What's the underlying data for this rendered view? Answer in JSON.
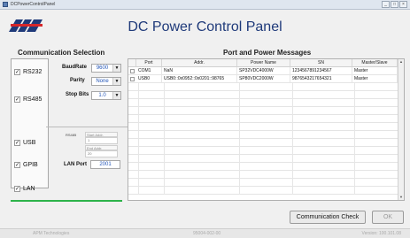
{
  "window": {
    "title": "DCPowerControlPanel"
  },
  "app": {
    "title": "DC Power Control Panel"
  },
  "sections": {
    "comm": "Communication Selection",
    "ports": "Port and Power Messages"
  },
  "comm_options": [
    {
      "label": "RS232",
      "checked": true
    },
    {
      "label": "RS485",
      "checked": true
    },
    {
      "label": "USB",
      "checked": true
    },
    {
      "label": "GPIB",
      "checked": true
    },
    {
      "label": "LAN",
      "checked": true
    }
  ],
  "rs232": {
    "baudrate_label": "BaudRate",
    "baudrate_value": "9600",
    "parity_label": "Parity",
    "parity_value": "None",
    "stopbits_label": "Stop Bits",
    "stopbits_value": "1.0"
  },
  "rs485": {
    "label": "RS485",
    "start_addr_placeholder": "Start Addr.",
    "start_addr_value": "1",
    "end_addr_placeholder": "End Addr.",
    "end_addr_value": "20"
  },
  "lan": {
    "port_label": "LAN Port",
    "port_value": "2001"
  },
  "table": {
    "columns": [
      "Port",
      "Addr.",
      "Power Name",
      "SN",
      "Master/Slave"
    ],
    "rows": [
      {
        "port": "COM1",
        "addr": "NaN",
        "name": "SP32VDC4000W",
        "sn": "1234567891234567",
        "role": "Master"
      },
      {
        "port": "USB0",
        "addr": "USB0::0x0952::0x0201::98765",
        "name": "SP80VDC2000W",
        "sn": "9876543217654321",
        "role": "Master"
      }
    ]
  },
  "buttons": {
    "check": "Communication Check",
    "ok": "OK"
  },
  "status": {
    "left": "APM Technologies",
    "center": "95004-002-00",
    "right": "Version: 100.101.08"
  },
  "colors": {
    "accent": "#1f3a7a",
    "value": "#2456b8",
    "progress": "#2db34a"
  }
}
